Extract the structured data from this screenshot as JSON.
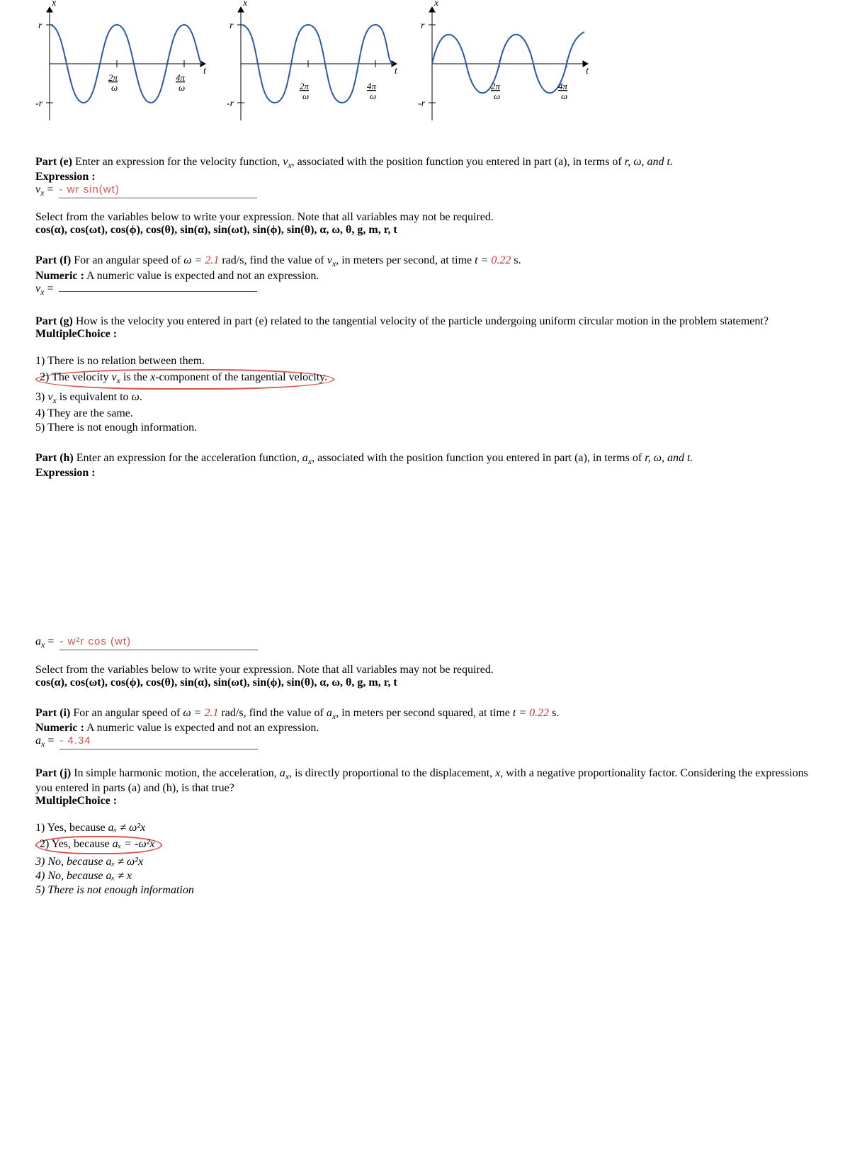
{
  "graphs": {
    "y_label": "x",
    "x_label": "t",
    "r_plus": "r",
    "r_minus": "-r",
    "tick1_num": "2π",
    "tick1_den": "ω",
    "tick2_num": "4π",
    "tick2_den": "ω"
  },
  "partE": {
    "label": "Part (e)",
    "text": " Enter an expression for the velocity function, ",
    "var": "v",
    "sub": "x",
    "text2": ", associated with the position function you entered in part (a), in terms of ",
    "vars_end": "r, ω, and t.",
    "type": "Expression   :",
    "lhs_var": "v",
    "lhs_sub": "x",
    "eq": " = ",
    "answer": "- wr sin(wt)",
    "select_text": "Select from the variables below to write your expression. Note that all variables may not be required.",
    "variables": "cos(α), cos(ωt), cos(ϕ), cos(θ), sin(α), sin(ωt), sin(ϕ), sin(θ), α, ω, θ, g, m, r, t"
  },
  "partF": {
    "label": "Part (f)",
    "text1": " For an angular speed of ",
    "omega": "ω = ",
    "val1": "2.1",
    "text2": " rad/s, find the value of ",
    "var": "v",
    "sub": "x",
    "text3": ", in meters per second, at time ",
    "t_eq": "t = ",
    "val2": "0.22",
    "text4": " s.",
    "type": "Numeric   :",
    "type_text": " A numeric value is expected and not an expression.",
    "lhs_var": "v",
    "lhs_sub": "x",
    "eq": " = "
  },
  "partG": {
    "label": "Part (g)",
    "text": " How is the velocity you entered in part (e) related to the tangential velocity of the particle undergoing uniform circular motion in the problem statement?",
    "type": "MultipleChoice   :",
    "opt1": "1) There is no relation between them.",
    "opt2_a": "2) The velocity ",
    "opt2_var": "v",
    "opt2_sub": "x",
    "opt2_b": " is the ",
    "opt2_c": "x",
    "opt2_d": "-component of the tangential velocity.",
    "opt3_a": "3) ",
    "opt3_var": "v",
    "opt3_sub": "x",
    "opt3_b": " is equivalent to ",
    "opt3_c": "ω",
    "opt3_d": ".",
    "opt4": "4) They are the same.",
    "opt5": "5) There is not enough information."
  },
  "partH": {
    "label": "Part (h)",
    "text": " Enter an expression for the acceleration function, ",
    "var": "a",
    "sub": "x",
    "text2": ", associated with the position function you entered in part (a), in terms of ",
    "vars_end": "r, ω, and t.",
    "type": "Expression   :",
    "lhs_var": "a",
    "lhs_sub": "x",
    "eq": " = ",
    "answer": "- w²r cos (wt)",
    "select_text": "Select from the variables below to write your expression. Note that all variables may not be required.",
    "variables": "cos(α), cos(ωt), cos(ϕ), cos(θ), sin(α), sin(ωt), sin(ϕ), sin(θ), α, ω, θ, g, m, r, t"
  },
  "partI": {
    "label": "Part (i)",
    "text1": " For an angular speed of ",
    "omega": "ω = ",
    "val1": "2.1",
    "text2": " rad/s, find the value of ",
    "var": "a",
    "sub": "x",
    "text3": ", in meters per second squared, at time ",
    "t_eq": "t = ",
    "val2": "0.22",
    "text4": " s.",
    "type": "Numeric   :",
    "type_text": " A numeric value is expected and not an expression.",
    "lhs_var": "a",
    "lhs_sub": "x",
    "eq": " = ",
    "answer": "- 4.34"
  },
  "partJ": {
    "label": "Part (j)",
    "text1": " In simple harmonic motion, the acceleration, ",
    "var": "a",
    "sub": "x",
    "text2": ", is directly proportional to the displacement, ",
    "x": "x",
    "text3": ", with a negative proportionality factor. Considering the expressions you entered in parts (a) and (h), is that true?",
    "type": "MultipleChoice   :",
    "opt1_a": "1) Yes, because ",
    "opt1_b": "aₓ ≠ ω²x",
    "opt2_a": "2) Yes, because ",
    "opt2_b": "aₓ = -ω²x",
    "opt3_a": "3) No, because ",
    "opt3_b": "aₓ ≠ ω²x",
    "opt4_a": "4) No, because ",
    "opt4_b": "aₓ ≠ x",
    "opt5": "5) There is not enough information"
  }
}
